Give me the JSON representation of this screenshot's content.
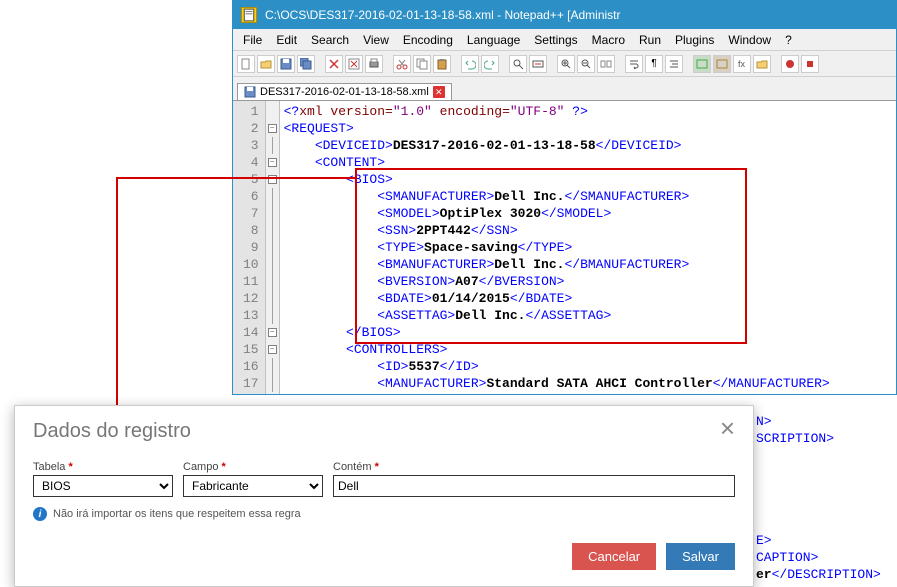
{
  "window": {
    "title": "C:\\OCS\\DES317-2016-02-01-13-18-58.xml - Notepad++ [Administr"
  },
  "menu": {
    "file": "File",
    "edit": "Edit",
    "search": "Search",
    "view": "View",
    "encoding": "Encoding",
    "language": "Language",
    "settings": "Settings",
    "macro": "Macro",
    "run": "Run",
    "plugins": "Plugins",
    "window": "Window",
    "help": "?"
  },
  "tab": {
    "name": "DES317-2016-02-01-13-18-58.xml"
  },
  "code": {
    "lines": [
      "<?xml version=\"1.0\" encoding=\"UTF-8\" ?>",
      "<REQUEST>",
      "    <DEVICEID>|DES317-2016-02-01-13-18-58|</DEVICEID>",
      "    <CONTENT>",
      "        <BIOS>",
      "            <SMANUFACTURER>|Dell Inc.|</SMANUFACTURER>",
      "            <SMODEL>|OptiPlex 3020|</SMODEL>",
      "            <SSN>|2PPT442|</SSN>",
      "            <TYPE>|Space-saving|</TYPE>",
      "            <BMANUFACTURER>|Dell Inc.|</BMANUFACTURER>",
      "            <BVERSION>|A07|</BVERSION>",
      "            <BDATE>|01/14/2015|</BDATE>",
      "            <ASSETTAG>|Dell Inc.|</ASSETTAG>",
      "        </BIOS>",
      "        <CONTROLLERS>",
      "            <ID>|5537|</ID>",
      "            <MANUFACTURER>|Standard SATA AHCI Controller|</MANUFACTURER>"
    ],
    "line_start": 1
  },
  "peek": {
    "l1a": "N>",
    "l1b": "SCRIPTION>",
    "l2a": "E>",
    "l2b": "CAPTION>",
    "l2c": "er</DESCRIPTION>"
  },
  "dialog": {
    "title": "Dados do registro",
    "tabela_label": "Tabela",
    "campo_label": "Campo",
    "contem_label": "Contém",
    "tabela_value": "BIOS",
    "campo_value": "Fabricante",
    "contem_value": "Dell",
    "note": "Não irá importar os itens que respeitem essa regra",
    "cancel": "Cancelar",
    "save": "Salvar"
  }
}
